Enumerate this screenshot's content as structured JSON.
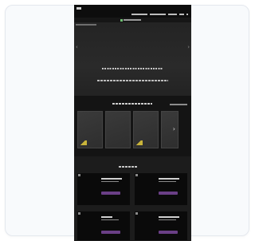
{
  "colors": {
    "page_background": "#ffffff",
    "card_background": "#f8fafc",
    "phone_background": "#1b1b1b",
    "accent_yellow": "#c9b43a",
    "button_purple": "#6a3f86"
  },
  "icons": {
    "hero_prev": "chevron-left-icon",
    "hero_next": "chevron-right-icon",
    "carousel_next": "chevron-right-icon"
  },
  "hero": {
    "prev_glyph": "‹",
    "next_glyph": "›"
  },
  "carousel": {
    "next_glyph": "›"
  }
}
